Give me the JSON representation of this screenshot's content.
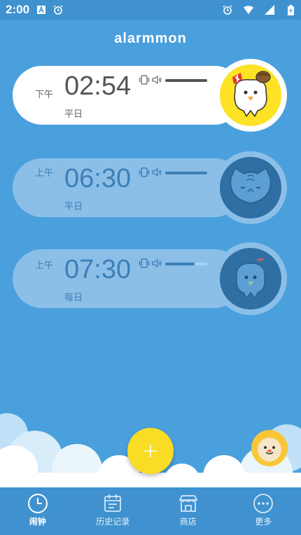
{
  "status_bar": {
    "time": "2:00"
  },
  "app": {
    "logo": "alarmmon"
  },
  "alarms": [
    {
      "period": "下午",
      "time": "02:54",
      "days": "平日",
      "volume": 1.0,
      "enabled": true,
      "character": "chick-with-acorn"
    },
    {
      "period": "上午",
      "time": "06:30",
      "days": "平日",
      "volume": 1.0,
      "enabled": false,
      "character": "cat"
    },
    {
      "period": "上午",
      "time": "07:30",
      "days": "每日",
      "volume": 0.7,
      "enabled": false,
      "character": "chick-with-ribbon"
    }
  ],
  "fab": {
    "icon": "plus-icon"
  },
  "nav": {
    "items": [
      {
        "label": "闹钟",
        "icon": "clock-icon"
      },
      {
        "label": "历史记录",
        "icon": "calendar-icon"
      },
      {
        "label": "商店",
        "icon": "store-icon"
      },
      {
        "label": "更多",
        "icon": "more-icon"
      }
    ]
  },
  "colors": {
    "background": "#4aa0dd",
    "accent_yellow": "#fde225",
    "inactive_card": "#8bbfe8"
  }
}
